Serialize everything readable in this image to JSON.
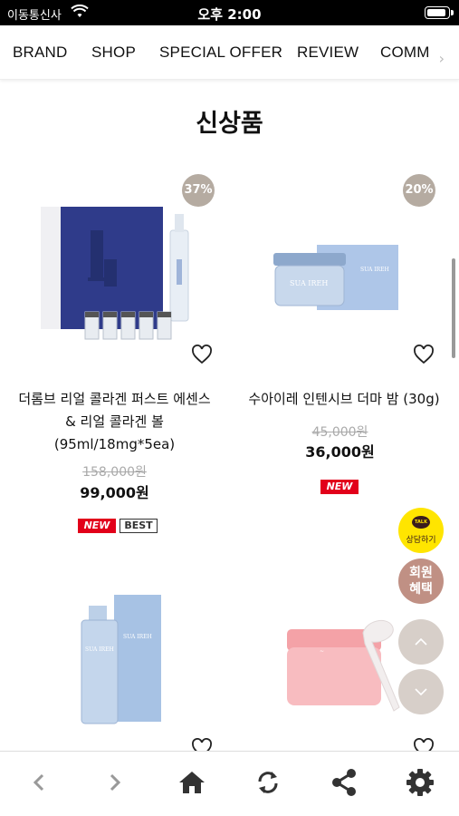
{
  "status_bar": {
    "carrier": "이동통신사",
    "time": "오후 2:00"
  },
  "nav": {
    "items": [
      "BRAND",
      "SHOP",
      "SPECIAL OFFER",
      "REVIEW",
      "COMM"
    ],
    "next_icon": "chevron-right-icon"
  },
  "section_title": "신상품",
  "products": [
    {
      "discount": "37%",
      "name_line1": "더롬브 리얼 콜라겐 퍼스트 에센스",
      "name_line2": "& 리얼 콜라겐 볼",
      "name_line3": "(95ml/18mg*5ea)",
      "original_price": "158,000원",
      "price": "99,000원",
      "badges": [
        "NEW",
        "BEST"
      ],
      "image_label": "collagen essence set"
    },
    {
      "discount": "20%",
      "name_line1": "수아이레 인텐시브 더마 밤 (30g)",
      "original_price": "45,000원",
      "price": "36,000원",
      "badges": [
        "NEW"
      ],
      "image_label": "SUA IREH derma balm jar",
      "brand_text": "SUA IREH"
    },
    {
      "image_label": "SUA IREH serum bottle",
      "brand_text": "SUA IREH"
    },
    {
      "image_label": "pink cream jar with spatula"
    }
  ],
  "floating": {
    "talk_label": "상담하기",
    "talk_bubble": "TALK",
    "member_label_1": "회원",
    "member_label_2": "혜택"
  },
  "toolbar": {
    "icons": [
      "back-icon",
      "forward-icon",
      "home-icon",
      "refresh-icon",
      "share-icon",
      "settings-icon"
    ]
  },
  "colors": {
    "discount_badge": "#b5aba1",
    "new_badge": "#e2001a",
    "talk": "#ffe500",
    "member": "#c09084",
    "scroll_btn": "#d7cfc9"
  }
}
